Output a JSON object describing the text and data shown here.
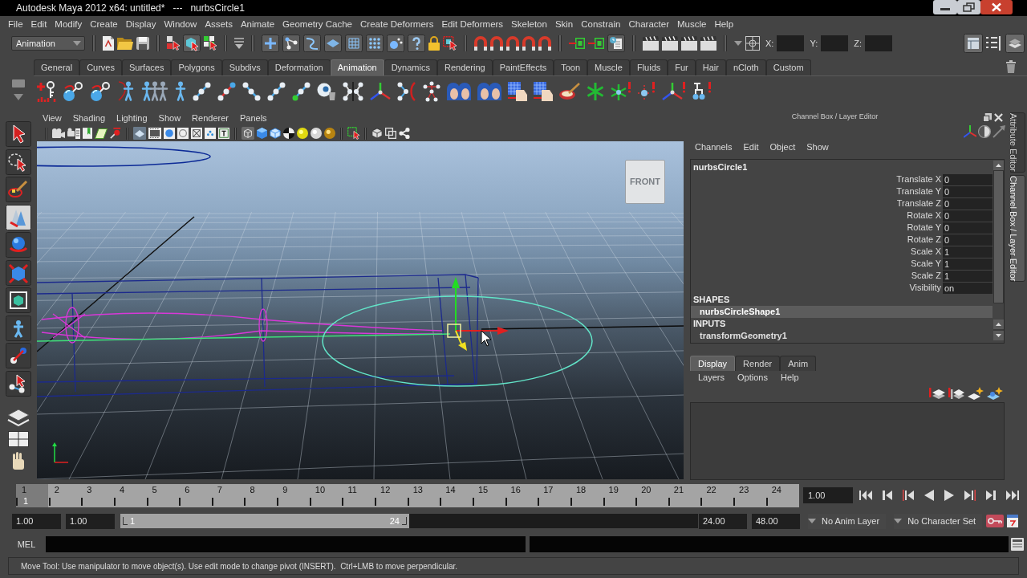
{
  "window": {
    "title": "Autodesk Maya 2012 x64: untitled*   ---   nurbsCircle1"
  },
  "menu_bar": [
    "File",
    "Edit",
    "Modify",
    "Create",
    "Display",
    "Window",
    "Assets",
    "Animate",
    "Geometry Cache",
    "Create Deformers",
    "Edit Deformers",
    "Skeleton",
    "Skin",
    "Constrain",
    "Character",
    "Muscle",
    "Help"
  ],
  "status_line": {
    "menu_set": "Animation",
    "coordinates": [
      {
        "label": "X:"
      },
      {
        "label": "Y:"
      },
      {
        "label": "Z:"
      }
    ]
  },
  "shelf": {
    "tabs": [
      {
        "label": "General",
        "selected": false
      },
      {
        "label": "Curves",
        "selected": false
      },
      {
        "label": "Surfaces",
        "selected": false
      },
      {
        "label": "Polygons",
        "selected": false
      },
      {
        "label": "Subdivs",
        "selected": false
      },
      {
        "label": "Deformation",
        "selected": false
      },
      {
        "label": "Animation",
        "selected": true
      },
      {
        "label": "Dynamics",
        "selected": false
      },
      {
        "label": "Rendering",
        "selected": false
      },
      {
        "label": "PaintEffects",
        "selected": false
      },
      {
        "label": "Toon",
        "selected": false
      },
      {
        "label": "Muscle",
        "selected": false
      },
      {
        "label": "Fluids",
        "selected": false
      },
      {
        "label": "Fur",
        "selected": false
      },
      {
        "label": "Hair",
        "selected": false
      },
      {
        "label": "nCloth",
        "selected": false
      },
      {
        "label": "Custom",
        "selected": false
      }
    ]
  },
  "toolbox": [
    {
      "selected": false
    },
    {
      "selected": false
    },
    {
      "selected": false
    },
    {
      "selected": true
    },
    {
      "selected": false
    },
    {
      "selected": false
    },
    {
      "selected": false
    },
    {
      "selected": false
    },
    {
      "selected": false
    },
    {
      "selected": false
    }
  ],
  "viewport": {
    "menu": [
      "View",
      "Shading",
      "Lighting",
      "Show",
      "Renderer",
      "Panels"
    ],
    "view_cube": "FRONT"
  },
  "channel_box": {
    "title": "Channel Box / Layer Editor",
    "menu": [
      "Channels",
      "Edit",
      "Object",
      "Show"
    ],
    "object": "nurbsCircle1",
    "channels": [
      {
        "name": "Translate X",
        "value": "0"
      },
      {
        "name": "Translate Y",
        "value": "0"
      },
      {
        "name": "Translate Z",
        "value": "0"
      },
      {
        "name": "Rotate X",
        "value": "0"
      },
      {
        "name": "Rotate Y",
        "value": "0"
      },
      {
        "name": "Rotate Z",
        "value": "0"
      },
      {
        "name": "Scale X",
        "value": "1"
      },
      {
        "name": "Scale Y",
        "value": "1"
      },
      {
        "name": "Scale Z",
        "value": "1"
      },
      {
        "name": "Visibility",
        "value": "on"
      }
    ],
    "sections": [
      {
        "heading": "SHAPES",
        "items": [
          {
            "label": "nurbsCircleShape1",
            "selected": true
          }
        ]
      },
      {
        "heading": "INPUTS",
        "items": [
          {
            "label": "transformGeometry1",
            "selected": false
          }
        ]
      }
    ]
  },
  "layer_editor": {
    "tabs": [
      {
        "label": "Display",
        "selected": true
      },
      {
        "label": "Render",
        "selected": false
      },
      {
        "label": "Anim",
        "selected": false
      }
    ],
    "menu": [
      "Layers",
      "Options",
      "Help"
    ]
  },
  "side_tabs": [
    {
      "label": "Attribute Editor",
      "selected": false
    },
    {
      "label": "Channel Box / Layer Editor",
      "selected": true
    }
  ],
  "time_slider": {
    "frames": [
      "1",
      "2",
      "3",
      "4",
      "5",
      "6",
      "7",
      "8",
      "9",
      "10",
      "11",
      "12",
      "13",
      "14",
      "15",
      "16",
      "17",
      "18",
      "19",
      "20",
      "21",
      "22",
      "23",
      "24"
    ],
    "current_frame": "1",
    "level": 0,
    "current_time": "1.00"
  },
  "range_slider": {
    "start_time": "1.00",
    "playback_start": "1.00",
    "range_start": "1",
    "range_end": "24",
    "level": 0.5,
    "playback_end": "24.00",
    "end_time": "48.00",
    "anim_layer": "No Anim Layer",
    "character_set": "No Character Set"
  },
  "command_line": {
    "language": "MEL"
  },
  "help_line": "Move Tool: Use manipulator to move object(s). Use edit mode to change pivot (INSERT).  Ctrl+LMB to move perpendicular."
}
